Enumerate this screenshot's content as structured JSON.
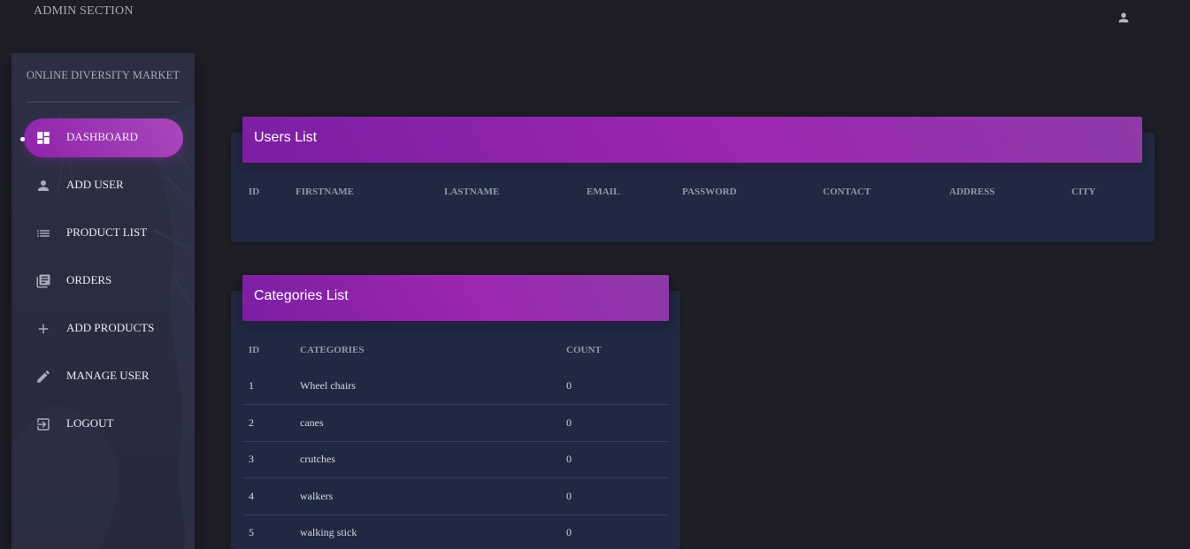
{
  "topbar": {
    "title": "ADMIN SECTION",
    "user_icon": "person-icon"
  },
  "sidebar": {
    "brand": "ONLINE DIVERSITY MARKET",
    "items": [
      {
        "label": "DASHBOARD",
        "icon": "dashboard-icon",
        "active": true
      },
      {
        "label": "ADD USER",
        "icon": "person-icon",
        "active": false
      },
      {
        "label": "PRODUCT LIST",
        "icon": "list-icon",
        "active": false
      },
      {
        "label": "ORDERS",
        "icon": "library-books-icon",
        "active": false
      },
      {
        "label": "ADD PRODUCTS",
        "icon": "plus-icon",
        "active": false
      },
      {
        "label": "MANAGE USER",
        "icon": "pencil-icon",
        "active": false
      },
      {
        "label": "LOGOUT",
        "icon": "logout-icon",
        "active": false
      }
    ],
    "accent_color": "#9c27b0"
  },
  "users_card": {
    "title": "Users List",
    "columns": [
      "ID",
      "FIRSTNAME",
      "LASTNAME",
      "EMAIL",
      "PASSWORD",
      "CONTACT",
      "ADDRESS",
      "CITY"
    ]
  },
  "categories_card": {
    "title": "Categories List",
    "columns": [
      "ID",
      "CATEGORIES",
      "COUNT"
    ],
    "rows": [
      {
        "id": "1",
        "name": "Wheel chairs",
        "count": "0"
      },
      {
        "id": "2",
        "name": "canes",
        "count": "0"
      },
      {
        "id": "3",
        "name": "crutches",
        "count": "0"
      },
      {
        "id": "4",
        "name": "walkers",
        "count": "0"
      },
      {
        "id": "5",
        "name": "walking stick",
        "count": "0"
      }
    ]
  }
}
